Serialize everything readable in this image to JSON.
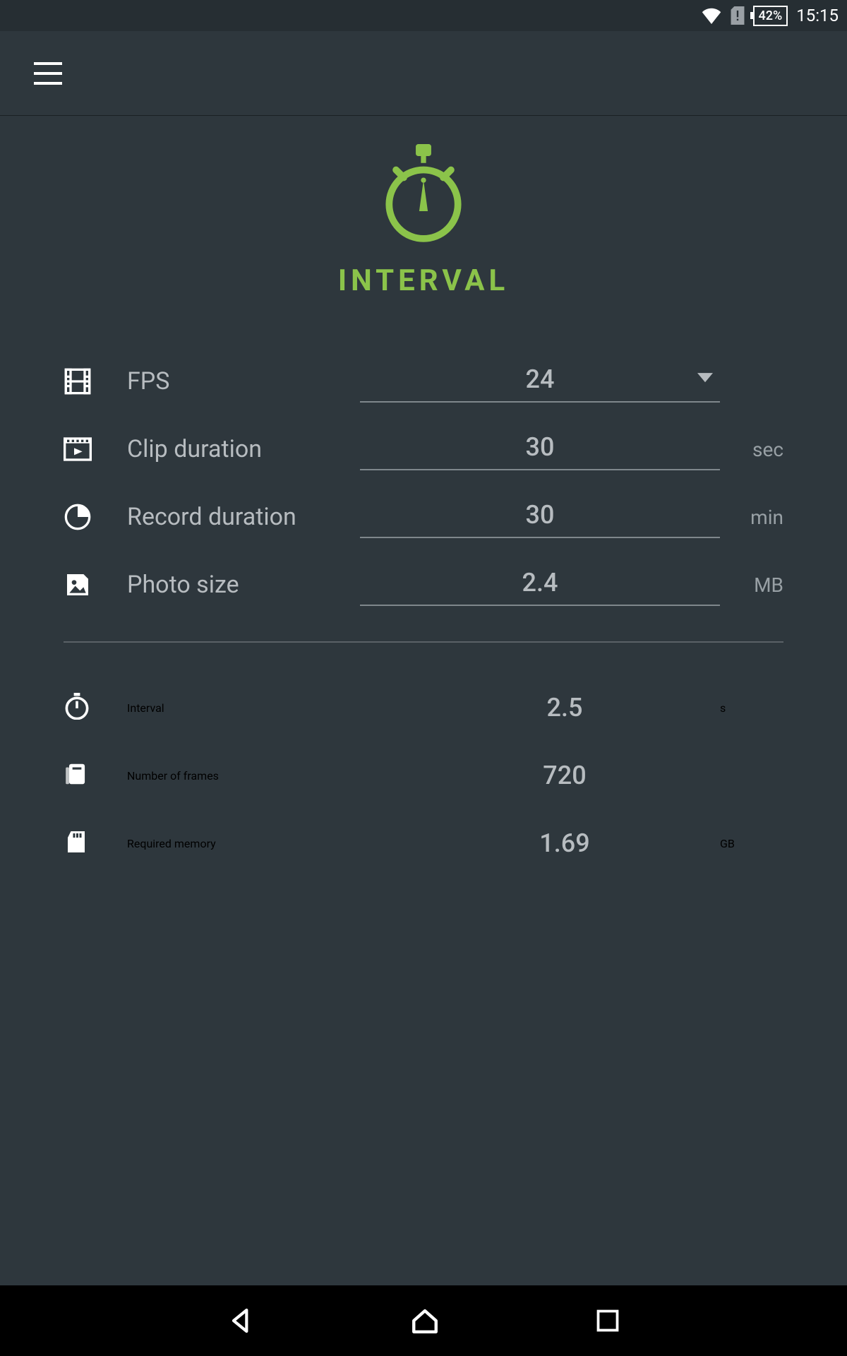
{
  "status_bar": {
    "battery": "42%",
    "clock": "15:15"
  },
  "hero": {
    "title": "INTERVAL"
  },
  "inputs": {
    "fps": {
      "label": "FPS",
      "value": "24",
      "unit": ""
    },
    "clip": {
      "label": "Clip duration",
      "value": "30",
      "unit": "sec"
    },
    "record": {
      "label": "Record duration",
      "value": "30",
      "unit": "min"
    },
    "photo": {
      "label": "Photo size",
      "value": "2.4",
      "unit": "MB"
    }
  },
  "outputs": {
    "interval": {
      "label": "Interval",
      "value": "2.5",
      "unit": "s"
    },
    "frames": {
      "label": "Number of frames",
      "value": "720",
      "unit": ""
    },
    "memory": {
      "label": "Required memory",
      "value": "1.69",
      "unit": "GB"
    }
  },
  "colors": {
    "accent": "#8bc34a",
    "bg": "#2e373d",
    "text_muted": "#b7bcc0"
  }
}
